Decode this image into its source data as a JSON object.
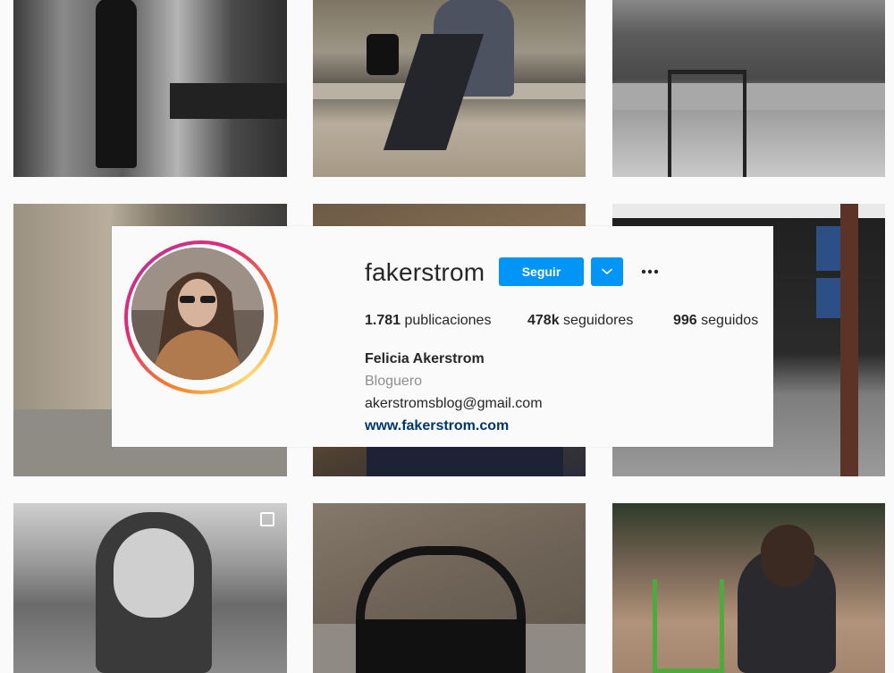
{
  "profile": {
    "username": "fakerstrom",
    "follow_label": "Seguir",
    "stats": {
      "posts_count": "1.781",
      "posts_label": "publicaciones",
      "followers_count": "478k",
      "followers_label": "seguidores",
      "following_count": "996",
      "following_label": "seguidos"
    },
    "full_name": "Felicia Akerstrom",
    "category": "Bloguero",
    "email": "akerstromsblog@gmail.com",
    "website": "www.fakerstrom.com"
  },
  "icons": {
    "dropdown": "chevron-down-icon",
    "more": "more-options-icon",
    "multi_post": "multi-post-icon"
  },
  "colors": {
    "primary_button": "#0095f6",
    "link": "#00376b",
    "secondary_text": "#8e8e8e",
    "story_ring": "#dd2a7b"
  }
}
